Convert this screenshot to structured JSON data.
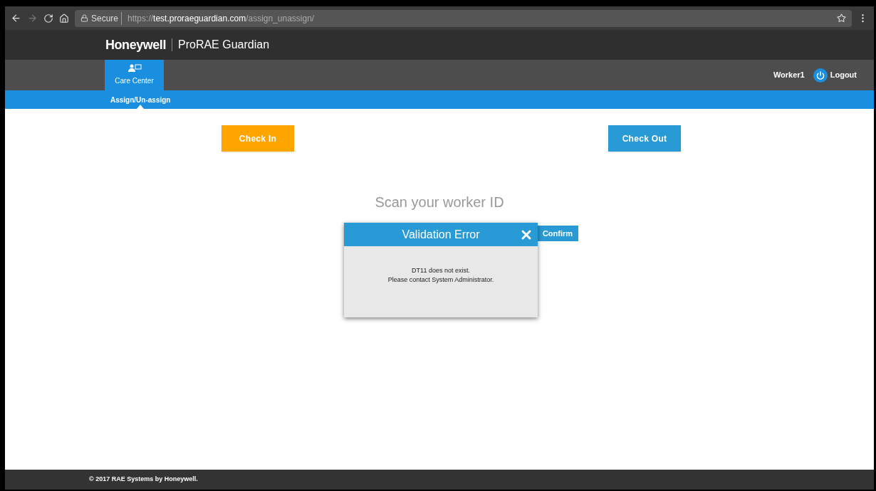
{
  "browser": {
    "security": "Secure",
    "url": {
      "scheme": "https://",
      "host": "test.proraeguardian.com",
      "path": "/assign_unassign/"
    }
  },
  "header": {
    "brand": "Honeywell",
    "product": "ProRAE Guardian"
  },
  "nav": {
    "tabs": [
      {
        "label": "Care Center",
        "selected": true
      }
    ],
    "user": "Worker1",
    "logout": "Logout"
  },
  "subnav": {
    "items": [
      {
        "label": "Assign/Un-assign",
        "selected": true
      }
    ]
  },
  "actions": {
    "check_in": "Check In",
    "check_out": "Check Out"
  },
  "scan": {
    "title": "Scan your worker ID",
    "confirm": "Confirm"
  },
  "dialog": {
    "title": "Validation Error",
    "lines": [
      "DT11 does not exist.",
      "Please contact System Administrator."
    ]
  },
  "footer": "© 2017 RAE Systems by Honeywell."
}
